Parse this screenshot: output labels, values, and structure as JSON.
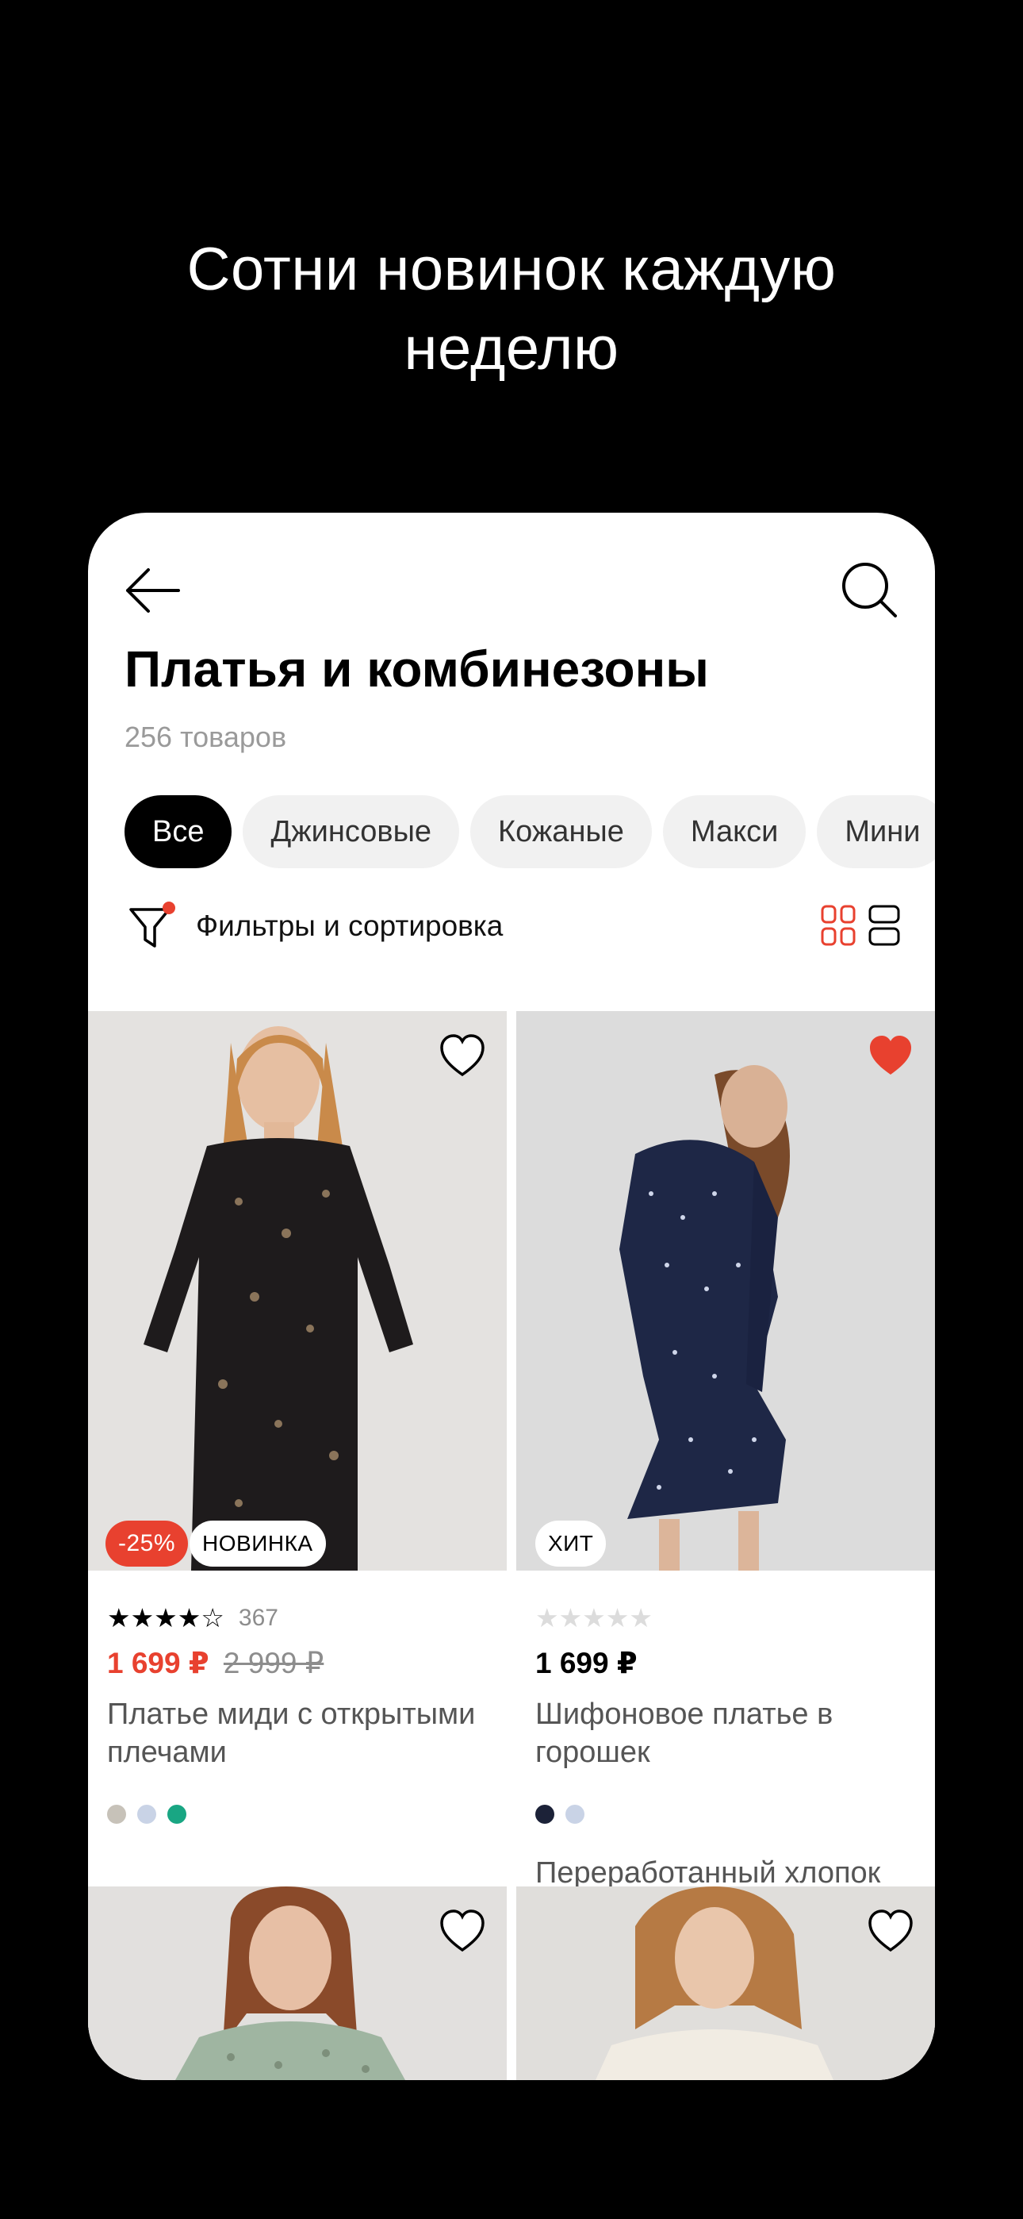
{
  "promo": {
    "line1": "Сотни новинок каждую",
    "line2": "неделю"
  },
  "header": {
    "title": "Платья и комбинезоны",
    "count": "256 товаров"
  },
  "chips": [
    "Все",
    "Джинсовые",
    "Кожаные",
    "Макси",
    "Мини"
  ],
  "filters": {
    "label": "Фильтры и сортировка"
  },
  "products": [
    {
      "rating_stars": "★★★★☆",
      "rating_count": "367",
      "price": "1 699 ₽",
      "old_price": "2 999 ₽",
      "name": "Платье миди с открытыми плечами",
      "discount_badge": "-25%",
      "tag_badge": "НОВИНКА",
      "favorite": false,
      "colors": [
        "#c7c2b9",
        "#c9d3e6",
        "#19a683"
      ]
    },
    {
      "rating_stars": "★★★★★",
      "price": "1 699 ₽",
      "name": "Шифоновое платье в горошек",
      "tag_badge": "ХИТ",
      "favorite": true,
      "colors": [
        "#1c2238",
        "#c9d3e6"
      ],
      "material": "Переработанный хлопок"
    }
  ],
  "colors": {
    "accent": "#e8412f",
    "background": "#000000",
    "chip_bg": "#f1f1f1"
  }
}
